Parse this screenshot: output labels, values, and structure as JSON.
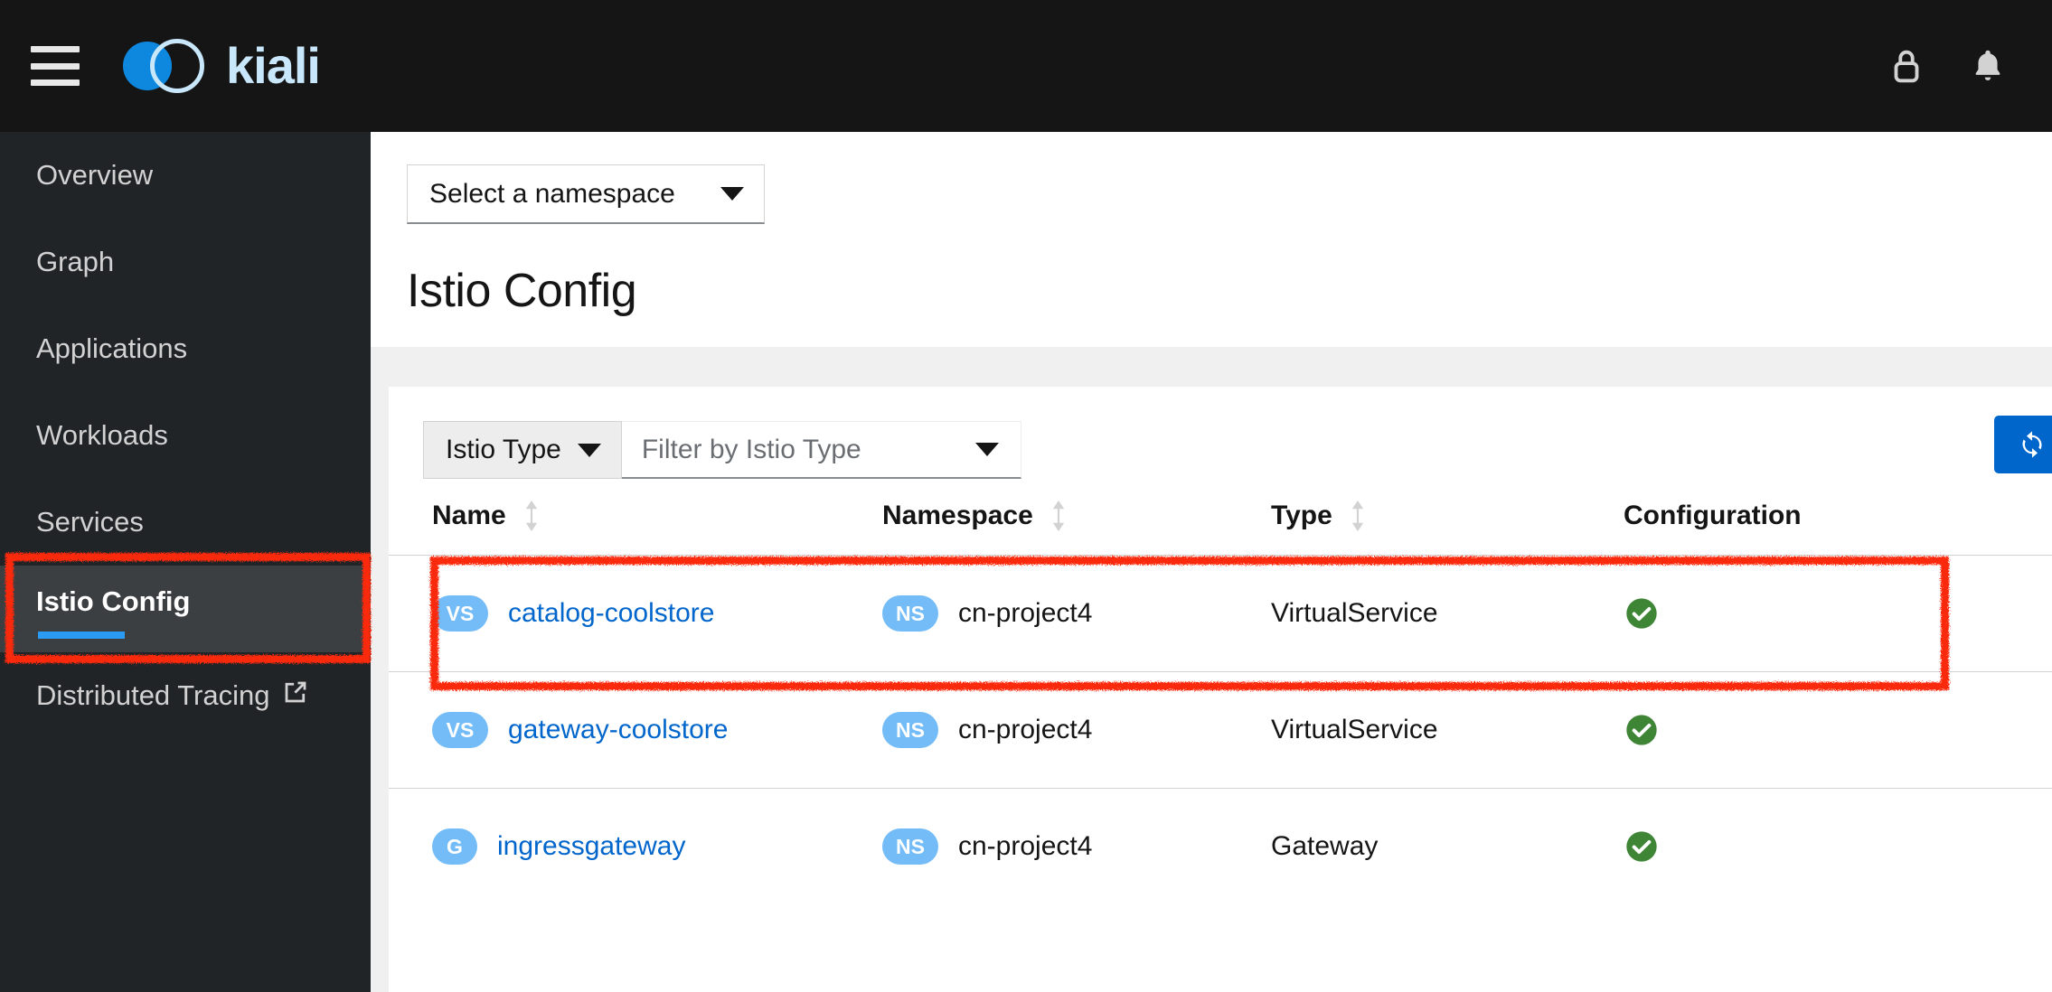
{
  "brand": {
    "name": "kiali"
  },
  "masthead": {
    "menu_icon": "hamburger-icon",
    "lock_icon": "lock-icon",
    "bell_icon": "bell-icon"
  },
  "sidebar": {
    "items": [
      {
        "label": "Overview",
        "active": false
      },
      {
        "label": "Graph",
        "active": false
      },
      {
        "label": "Applications",
        "active": false
      },
      {
        "label": "Workloads",
        "active": false
      },
      {
        "label": "Services",
        "active": false
      },
      {
        "label": "Istio Config",
        "active": true
      },
      {
        "label": "Distributed Tracing",
        "active": false,
        "external": true
      }
    ]
  },
  "namespace_select": {
    "value": "Select a namespace"
  },
  "page": {
    "title": "Istio Config"
  },
  "toolbar": {
    "type_filter_label": "Istio Type",
    "filter_placeholder": "Filter by Istio Type",
    "refresh_label": "refresh-icon",
    "accent_color": "#0066cc"
  },
  "table": {
    "columns": [
      {
        "label": "Name",
        "sortable": true
      },
      {
        "label": "Namespace",
        "sortable": true
      },
      {
        "label": "Type",
        "sortable": true
      },
      {
        "label": "Configuration",
        "sortable": false
      }
    ],
    "rows": [
      {
        "name_badge": "VS",
        "name": "catalog-coolstore",
        "ns_badge": "NS",
        "namespace": "cn-project4",
        "type": "VirtualService",
        "configuration": "valid",
        "highlighted": true
      },
      {
        "name_badge": "VS",
        "name": "gateway-coolstore",
        "ns_badge": "NS",
        "namespace": "cn-project4",
        "type": "VirtualService",
        "configuration": "valid",
        "highlighted": false
      },
      {
        "name_badge": "G",
        "name": "ingressgateway",
        "ns_badge": "NS",
        "namespace": "cn-project4",
        "type": "Gateway",
        "configuration": "valid",
        "highlighted": false
      }
    ]
  },
  "colors": {
    "badge_blue": "#73bcf7",
    "link_blue": "#0066cc",
    "status_green": "#3e8635",
    "annotation_red": "#fb2b10",
    "nav_active_underline": "#2b9af3"
  }
}
